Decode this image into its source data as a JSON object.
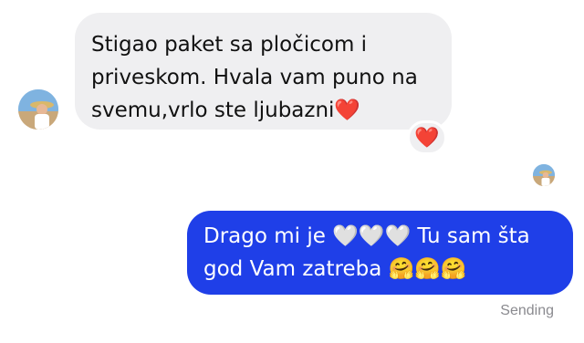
{
  "thread": {
    "incoming": {
      "text": "Stigao paket sa pločicom i\npriveskom. Hvala vam puno na\nsvemu,vrlo ste ljubazni❤️",
      "reaction": "❤️"
    },
    "outgoing": {
      "text": "Drago mi je 🤍🤍🤍 Tu sam šta\ngod Vam zatreba 🤗🤗🤗",
      "status": "Sending"
    }
  },
  "colors": {
    "incoming_bubble": "#efeff1",
    "outgoing_bubble": "#1f3fe8",
    "reaction_heart": "#e0282e",
    "status_text": "#8a8a8f"
  },
  "icons": {
    "sender_avatar": "profile-photo",
    "read_receipt_avatar": "profile-photo",
    "reaction": "red-heart-icon"
  }
}
